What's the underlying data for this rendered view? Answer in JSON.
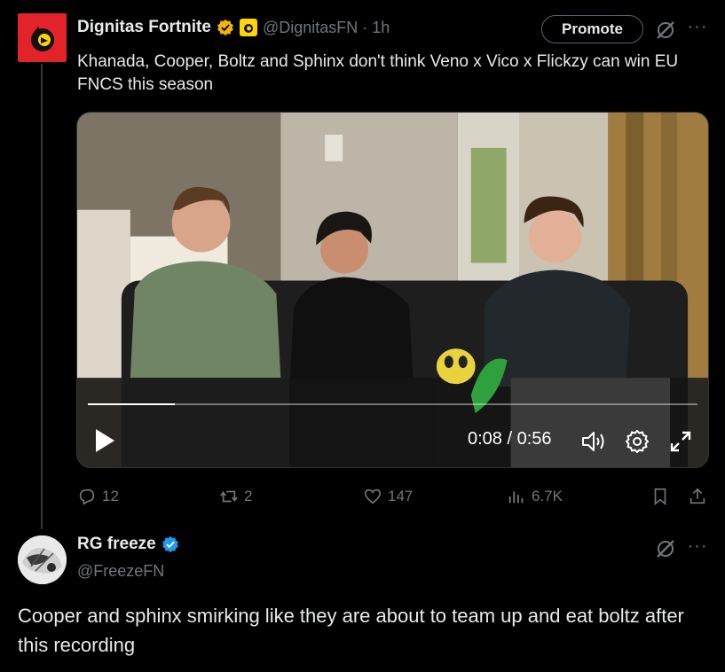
{
  "tweet1": {
    "display_name": "Dignitas Fortnite",
    "handle_time": "@DignitasFN · 1h",
    "promote_label": "Promote",
    "more_label": "···",
    "text": "Khanada, Cooper, Boltz and Sphinx don't think Veno x Vico x Flickzy can win EU FNCS this season",
    "video": {
      "time": "0:08 / 0:56",
      "progress_fraction": 0.143
    },
    "actions": {
      "replies": "12",
      "reposts": "2",
      "likes": "147",
      "views": "6.7K"
    },
    "icons": [
      "verified-gold-icon",
      "affiliate-badge-icon",
      "grok-icon",
      "more-icon",
      "play-icon",
      "volume-icon",
      "settings-icon",
      "fullscreen-icon",
      "reply-icon",
      "repost-icon",
      "like-icon",
      "views-icon",
      "bookmark-icon",
      "share-icon"
    ]
  },
  "tweet2": {
    "display_name": "RG freeze",
    "handle": "@FreezeFN",
    "more_label": "···",
    "text": "Cooper and sphinx smirking like they are about to team up and eat boltz after this recording",
    "icons": [
      "verified-blue-icon",
      "grok-icon",
      "more-icon"
    ]
  },
  "colors": {
    "background": "#000000",
    "text": "#e7e9ea",
    "muted": "#71767b",
    "gold_badge": "#f4b400",
    "blue_badge": "#1d9bf0",
    "avatar_red": "#e2232a"
  }
}
